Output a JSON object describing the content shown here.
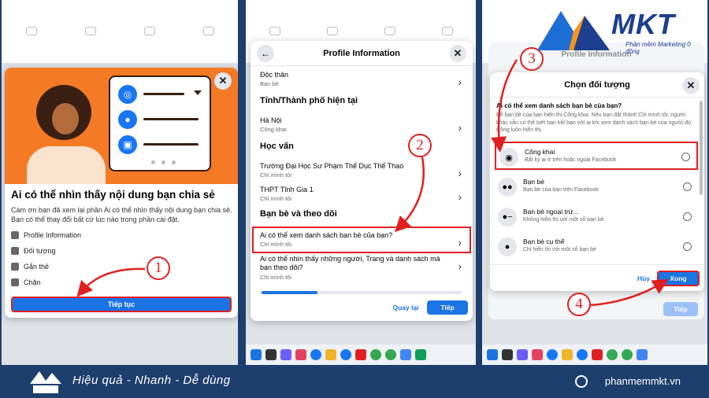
{
  "panel1": {
    "title": "Ai có thể nhìn thấy nội dung bạn chia sẻ",
    "description": "Cám ơn bạn đã xem lại phần Ai có thể nhìn thấy nội dung bạn chia sẻ. Bạn có thể thay đổi bất cứ lúc nào trong phần cài đặt.",
    "items": [
      "Profile Information",
      "Đối tượng",
      "Gắn thẻ",
      "Chặn"
    ],
    "continue_label": "Tiếp tục",
    "step": "1"
  },
  "panel2": {
    "title": "Profile Information",
    "rows": [
      {
        "title": "Độc thân",
        "sub": "Bạn bè"
      },
      {
        "title": "Hà Nội",
        "sub": "Công khai"
      },
      {
        "title": "Trường Đại Học Sư Phạm Thể Dục Thể Thao",
        "sub": "Chỉ mình tôi"
      },
      {
        "title": "THPT Tĩnh Gia 1",
        "sub": "Chỉ mình tôi"
      },
      {
        "title": "Ai có thể xem danh sách bạn bè của bạn?",
        "sub": "Chỉ mình tôi"
      },
      {
        "title": "Ai có thể nhìn thấy những người, Trang và danh sách mà bạn theo dõi?",
        "sub": "Chỉ mình tôi"
      }
    ],
    "sections": [
      "Tỉnh/Thành phố hiện tại",
      "Học vấn",
      "Bạn bè và theo dõi"
    ],
    "progress": 0.28,
    "back_label": "Quay lại",
    "next_label": "Tiếp",
    "step": "2"
  },
  "panel3": {
    "behind_title": "Profile Information",
    "title": "Chọn đối tượng",
    "question": "Ai có thể xem danh sách bạn bè của bạn?",
    "question_desc": "Bố bạn bè của bạn hiển thị Công khai. Nếu bạn đặt thành Chỉ mình tôi, người khác vẫn có thể biết bạn kết bạn với ai khi xem danh sách bạn bè của người đó. Công luôn hiển thị.",
    "options": [
      {
        "title": "Công khai",
        "sub": "Bất kỳ ai ở trên hoặc ngoài Facebook",
        "icon": "globe-icon"
      },
      {
        "title": "Bạn bè",
        "sub": "Bạn bè của bạn trên Facebook",
        "icon": "friends-icon"
      },
      {
        "title": "Bạn bè ngoại trừ...",
        "sub": "Không hiển thị với một số bạn bè",
        "icon": "friends-except-icon"
      },
      {
        "title": "Bạn bè cụ thể",
        "sub": "Chỉ hiển thị với một số bạn bè",
        "icon": "specific-friends-icon"
      }
    ],
    "cancel_label": "Hủy",
    "done_label": "Xong",
    "behind_next": "Tiếp",
    "step3": "3",
    "step4": "4"
  },
  "brand": {
    "logo_text": "MKT",
    "logo_sub": "Phần mềm Marketing 0 đồng",
    "slogan": "Hiệu quả - Nhanh - Dễ dùng",
    "site": "phanmemmkt.vn",
    "colors": {
      "accent": "#1b74e4",
      "highlight": "#e02020",
      "brand": "#1d3f6e"
    }
  }
}
